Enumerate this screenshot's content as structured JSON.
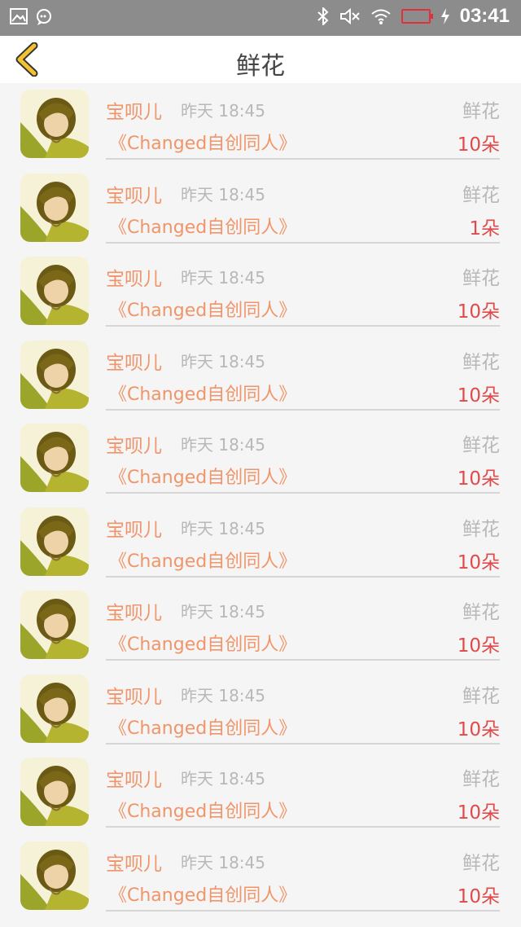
{
  "status_bar": {
    "time": "03:41",
    "left_icons": [
      "image-icon",
      "chat-icon"
    ],
    "right_icons": [
      "bluetooth-icon",
      "mute-icon",
      "wifi-icon",
      "battery-icon",
      "charging-icon"
    ],
    "battery_color": "#e0303a"
  },
  "header": {
    "title": "鲜花",
    "back_icon": "chevron-left-icon",
    "accent": "#f2c230"
  },
  "colors": {
    "name": "#f0956a",
    "count": "#e04a4a",
    "muted": "#b8b8b8"
  },
  "items": [
    {
      "user": "宝呗儿",
      "time": "昨天 18:45",
      "gift": "鲜花",
      "work": "《Changed自创同人》",
      "count": "10朵"
    },
    {
      "user": "宝呗儿",
      "time": "昨天 18:45",
      "gift": "鲜花",
      "work": "《Changed自创同人》",
      "count": "1朵"
    },
    {
      "user": "宝呗儿",
      "time": "昨天 18:45",
      "gift": "鲜花",
      "work": "《Changed自创同人》",
      "count": "10朵"
    },
    {
      "user": "宝呗儿",
      "time": "昨天 18:45",
      "gift": "鲜花",
      "work": "《Changed自创同人》",
      "count": "10朵"
    },
    {
      "user": "宝呗儿",
      "time": "昨天 18:45",
      "gift": "鲜花",
      "work": "《Changed自创同人》",
      "count": "10朵"
    },
    {
      "user": "宝呗儿",
      "time": "昨天 18:45",
      "gift": "鲜花",
      "work": "《Changed自创同人》",
      "count": "10朵"
    },
    {
      "user": "宝呗儿",
      "time": "昨天 18:45",
      "gift": "鲜花",
      "work": "《Changed自创同人》",
      "count": "10朵"
    },
    {
      "user": "宝呗儿",
      "time": "昨天 18:45",
      "gift": "鲜花",
      "work": "《Changed自创同人》",
      "count": "10朵"
    },
    {
      "user": "宝呗儿",
      "time": "昨天 18:45",
      "gift": "鲜花",
      "work": "《Changed自创同人》",
      "count": "10朵"
    },
    {
      "user": "宝呗儿",
      "time": "昨天 18:45",
      "gift": "鲜花",
      "work": "《Changed自创同人》",
      "count": "10朵"
    }
  ]
}
